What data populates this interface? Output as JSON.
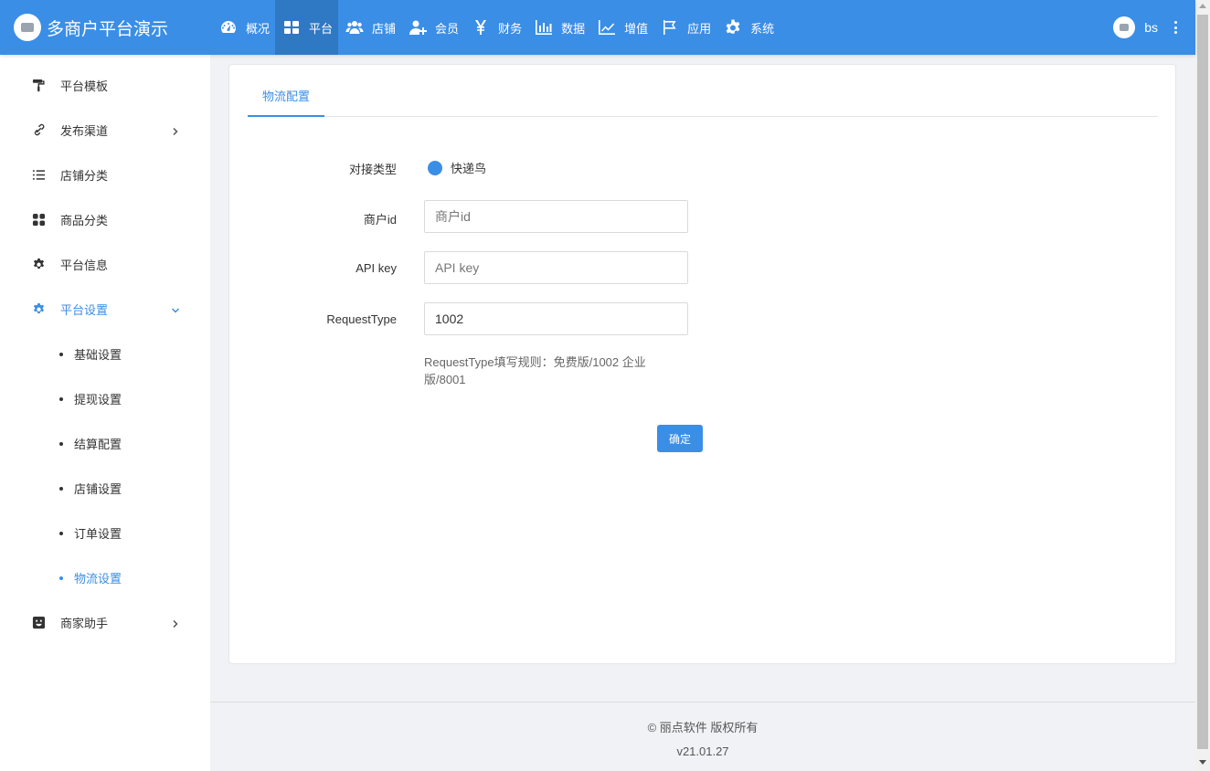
{
  "header": {
    "brand_title": "多商户平台演示",
    "nav": [
      {
        "label": "概况",
        "icon": "dashboard-icon"
      },
      {
        "label": "平台",
        "icon": "grid-icon"
      },
      {
        "label": "店铺",
        "icon": "users-icon"
      },
      {
        "label": "会员",
        "icon": "user-plus-icon"
      },
      {
        "label": "财务",
        "icon": "yen-icon"
      },
      {
        "label": "数据",
        "icon": "bar-chart-icon"
      },
      {
        "label": "增值",
        "icon": "line-chart-icon"
      },
      {
        "label": "应用",
        "icon": "flag-icon"
      },
      {
        "label": "系统",
        "icon": "gear-icon"
      }
    ],
    "active_nav": "平台",
    "username": "bs"
  },
  "sidebar": {
    "items": [
      {
        "label": "平台模板",
        "icon": "paint-roller-icon"
      },
      {
        "label": "发布渠道",
        "icon": "link-icon"
      },
      {
        "label": "店铺分类",
        "icon": "list-icon"
      },
      {
        "label": "商品分类",
        "icon": "apps-icon"
      },
      {
        "label": "平台信息",
        "icon": "gear-icon"
      },
      {
        "label": "平台设置",
        "icon": "gear-icon"
      },
      {
        "label": "商家助手",
        "icon": "smile-icon"
      }
    ],
    "sub_items": [
      {
        "label": "基础设置"
      },
      {
        "label": "提现设置"
      },
      {
        "label": "结算配置"
      },
      {
        "label": "店铺设置"
      },
      {
        "label": "订单设置"
      },
      {
        "label": "物流设置"
      }
    ],
    "active_sub": "物流设置"
  },
  "main": {
    "tab_label": "物流配置",
    "form": {
      "type_label": "对接类型",
      "type_option": "快递鸟",
      "merchant_label": "商户id",
      "merchant_placeholder": "商户id",
      "apikey_label": "API key",
      "apikey_placeholder": "API key",
      "reqtype_label": "RequestType",
      "reqtype_value": "1002",
      "hint": "RequestType填写规则：免费版/1002 企业版/8001",
      "submit_label": "确定"
    }
  },
  "footer": {
    "copyright": "© 丽点软件 版权所有",
    "version": "v21.01.27"
  },
  "colors": {
    "primary": "#3a8ee6",
    "header_active": "#2f78c4"
  }
}
